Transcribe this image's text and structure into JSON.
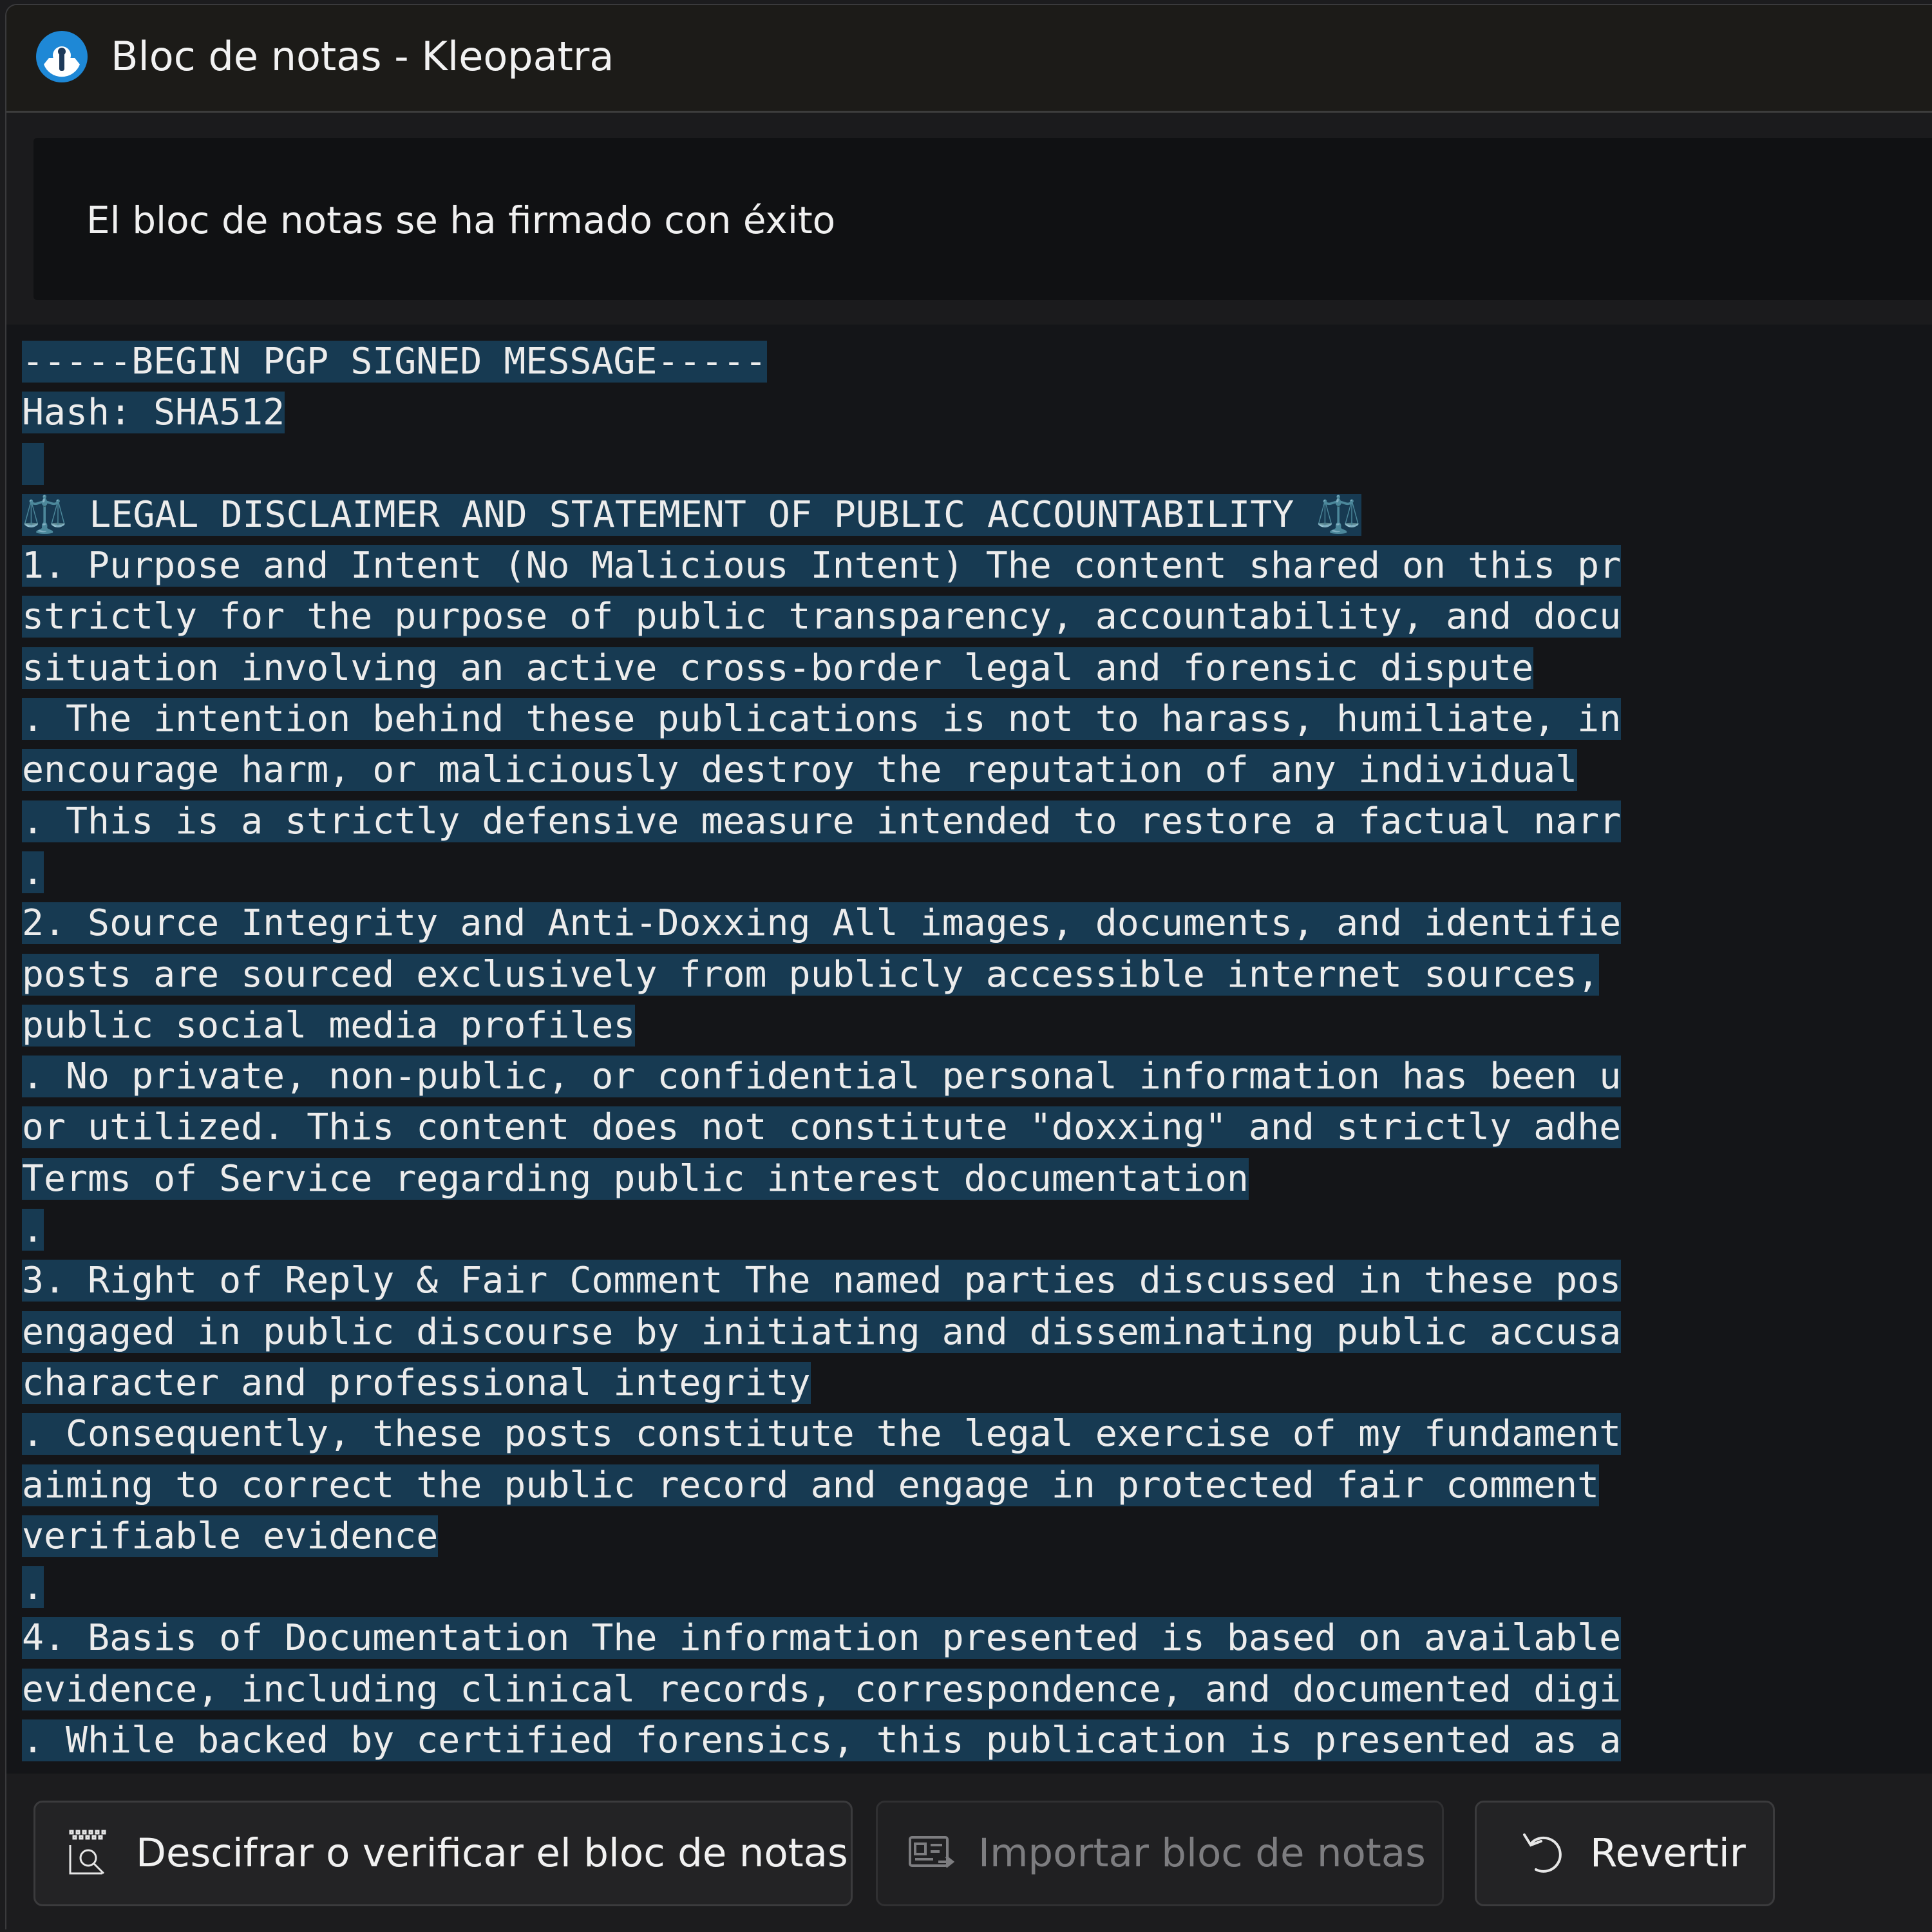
{
  "window": {
    "title": "Bloc de notas - Kleopatra"
  },
  "notification": {
    "text": "El bloc de notas se ha firmado con éxito"
  },
  "editor": {
    "lines": [
      "-----BEGIN PGP SIGNED MESSAGE-----",
      "Hash: SHA512",
      " ",
      "⚖️ LEGAL DISCLAIMER AND STATEMENT OF PUBLIC ACCOUNTABILITY ⚖️",
      "1. Purpose and Intent (No Malicious Intent) The content shared on this pr",
      "strictly for the purpose of public transparency, accountability, and docu",
      "situation involving an active cross-border legal and forensic dispute",
      ". The intention behind these publications is not to harass, humiliate, in",
      "encourage harm, or maliciously destroy the reputation of any individual",
      ". This is a strictly defensive measure intended to restore a factual narr",
      ".",
      "2. Source Integrity and Anti-Doxxing All images, documents, and identifie",
      "posts are sourced exclusively from publicly accessible internet sources,",
      "public social media profiles",
      ". No private, non-public, or confidential personal information has been u",
      "or utilized. This content does not constitute \"doxxing\" and strictly adhe",
      "Terms of Service regarding public interest documentation",
      ".",
      "3. Right of Reply & Fair Comment The named parties discussed in these pos",
      "engaged in public discourse by initiating and disseminating public accusa",
      "character and professional integrity",
      ". Consequently, these posts constitute the legal exercise of my fundament",
      "aiming to correct the public record and engage in protected fair comment",
      "verifiable evidence",
      ".",
      "4. Basis of Documentation The information presented is based on available",
      "evidence, including clinical records, correspondence, and documented digi",
      ". While backed by certified forensics, this publication is presented as a"
    ]
  },
  "buttons": {
    "decrypt": {
      "label": "Descifrar o verificar el bloc de notas",
      "icon": "decrypt-verify-icon"
    },
    "import": {
      "label": "Importar bloc de notas",
      "icon": "import-certificate-icon",
      "enabled": false
    },
    "revert": {
      "label": "Revertir",
      "icon": "undo-icon"
    }
  },
  "colors": {
    "selection": "#173a52",
    "editor_background": "#141518",
    "titlebar": "#1c1b18"
  }
}
